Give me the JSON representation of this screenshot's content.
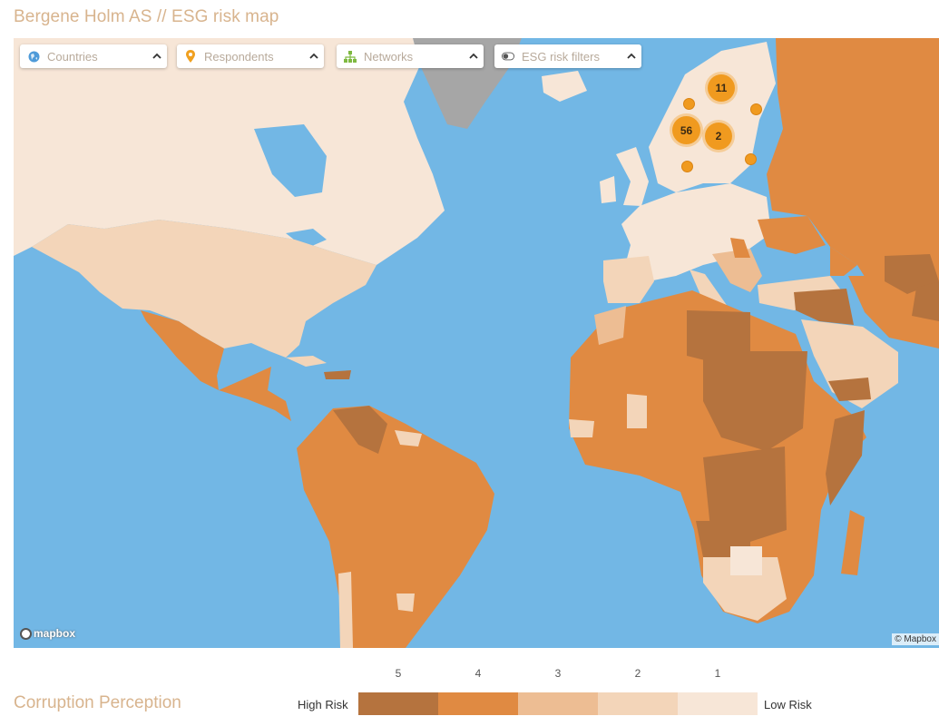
{
  "page": {
    "title": "Bergene Holm AS // ESG risk map"
  },
  "controls": [
    {
      "label": "Countries",
      "icon": "globe-icon",
      "icon_color": "#4f9bd9"
    },
    {
      "label": "Respondents",
      "icon": "map-pin-icon",
      "icon_color": "#f0a020"
    },
    {
      "label": "Networks",
      "icon": "network-icon",
      "icon_color": "#7fb941"
    },
    {
      "label": "ESG risk filters",
      "icon": "toggle-icon",
      "icon_color": "#555555"
    }
  ],
  "clusters": [
    {
      "count": "11"
    },
    {
      "count": "56"
    },
    {
      "count": "2"
    }
  ],
  "map": {
    "logo_text": "mapbox",
    "attribution": "© Mapbox",
    "ocean_color": "#72b7e5"
  },
  "legend": {
    "title": "Corruption Perception",
    "high_label": "High Risk",
    "low_label": "Low Risk",
    "levels": [
      "5",
      "4",
      "3",
      "2",
      "1"
    ],
    "colors": [
      "#b5733e",
      "#e08a42",
      "#edbd93",
      "#f3d5b9",
      "#f7e6d7"
    ]
  }
}
